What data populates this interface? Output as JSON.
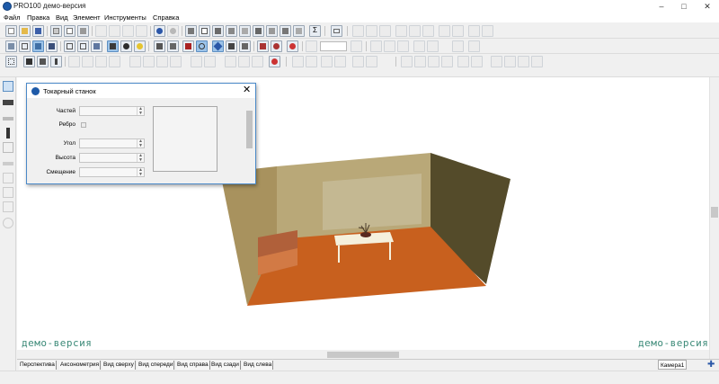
{
  "window": {
    "title": "PRO100 демо-версия",
    "minimize": "–",
    "maximize": "□",
    "close": "✕"
  },
  "menu": [
    "Файл",
    "Правка",
    "Вид",
    "Элемент",
    "Инструменты",
    "Справка"
  ],
  "viewport": {
    "watermark_left": "демо-версия",
    "watermark_right": "демо-версия"
  },
  "view_tabs": [
    "Перспектива",
    "Аксонометрия",
    "Вид сверху",
    "Вид спереди",
    "Вид справа",
    "Вид сзади",
    "Вид слева"
  ],
  "camera_tab": "Камера1",
  "dialog": {
    "title": "Токарный станок",
    "close": "✕",
    "fields": {
      "parts_label": "Частей",
      "rib_label": "Ребро",
      "angle_label": "Угол",
      "height_label": "Высота",
      "offset_label": "Смещение"
    },
    "spin_up": "▲",
    "spin_down": "▼"
  },
  "colors": {
    "accent": "#1e5aa8",
    "floor": "#c8601e",
    "wall_left": "#a8925e",
    "wall_back": "#b9a878",
    "wall_right": "#544b2a",
    "watermark": "#3c8a78"
  },
  "icons": {
    "toolbar1": [
      "new-file-icon",
      "open-icon",
      "save-icon",
      "export-icon",
      "print-preview-icon",
      "print-icon",
      "cut-icon",
      "copy-icon",
      "paste-icon",
      "delete-icon",
      "undo-icon",
      "redo-icon",
      "import-icon",
      "properties-icon",
      "sum-icon",
      "keyboard-icon"
    ],
    "toolbar2": [
      "cube-icon",
      "wire-icon",
      "zoom-in-icon",
      "zoom-out-icon"
    ],
    "toolbar3": [
      "grid-icon",
      "pin-icon"
    ]
  }
}
